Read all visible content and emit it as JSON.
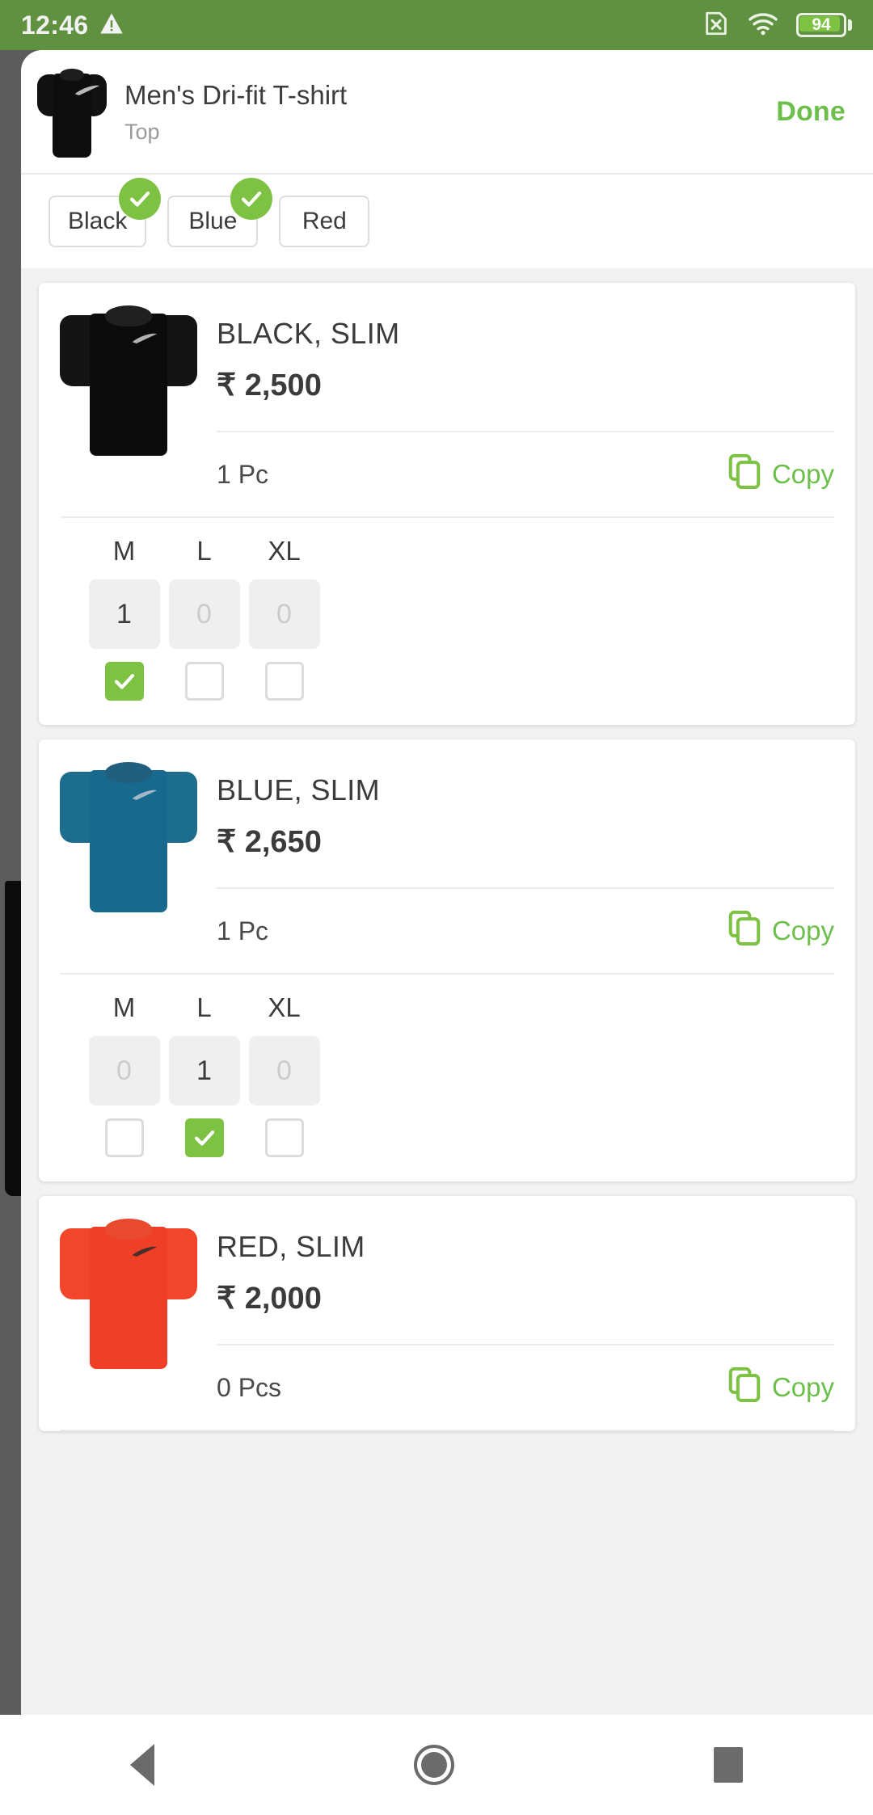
{
  "status_bar": {
    "time": "12:46",
    "warning_icon": "warning-triangle-icon",
    "sim_icon": "sim-card-x-icon",
    "wifi_icon": "wifi-icon",
    "battery_level": "94",
    "background_color": "#5f9141"
  },
  "header": {
    "product_title": "Men's Dri-fit T-shirt",
    "product_category": "Top",
    "done_label": "Done",
    "done_color": "#6cbf4b",
    "thumbnail": "black-tshirt-thumbnail"
  },
  "color_chips": [
    {
      "label": "Black",
      "selected": true
    },
    {
      "label": "Blue",
      "selected": true
    },
    {
      "label": "Red",
      "selected": false
    }
  ],
  "variant_cards": [
    {
      "name": "BLACK, SLIM",
      "price": "₹ 2,500",
      "pieces": "1 Pc",
      "copy_label": "Copy",
      "image": "black-tshirt-image",
      "swatch": "#121212",
      "swatch_dark": "#000000",
      "sizes": [
        {
          "label": "M",
          "qty": "1",
          "active": true,
          "checked": true
        },
        {
          "label": "L",
          "qty": "0",
          "active": false,
          "checked": false
        },
        {
          "label": "XL",
          "qty": "0",
          "active": false,
          "checked": false
        }
      ]
    },
    {
      "name": "BLUE, SLIM",
      "price": "₹ 2,650",
      "pieces": "1 Pc",
      "copy_label": "Copy",
      "image": "blue-tshirt-image",
      "swatch": "#1b6f91",
      "swatch_dark": "#124f6b",
      "sizes": [
        {
          "label": "M",
          "qty": "0",
          "active": false,
          "checked": false
        },
        {
          "label": "L",
          "qty": "1",
          "active": true,
          "checked": true
        },
        {
          "label": "XL",
          "qty": "0",
          "active": false,
          "checked": false
        }
      ]
    },
    {
      "name": "RED, SLIM",
      "price": "₹ 2,000",
      "pieces": "0 Pcs",
      "copy_label": "Copy",
      "image": "red-tshirt-image",
      "swatch": "#f0402a",
      "swatch_dark": "#d02d18",
      "sizes": []
    }
  ],
  "nav_bar": {
    "back": "back-triangle-icon",
    "home": "home-circle-icon",
    "recents": "recent-apps-square-icon"
  },
  "theme": {
    "green": "#7dc242",
    "green_text": "#6cbf4b",
    "page_bg": "#f2f2f2",
    "card_bg": "#ffffff"
  }
}
